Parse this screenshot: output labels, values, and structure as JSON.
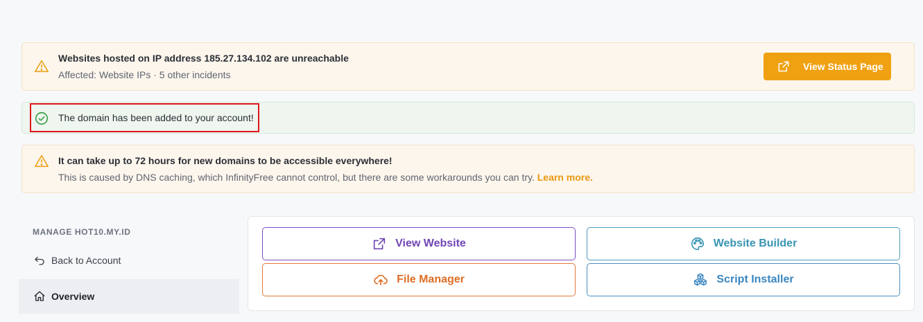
{
  "alerts": {
    "incident": {
      "title": "Websites hosted on IP address 185.27.134.102 are unreachable",
      "subtitle": "Affected: Website IPs · 5 other incidents",
      "button_label": "View Status Page",
      "icon": "warning-triangle-icon"
    },
    "success": {
      "text": "The domain has been added to your account!",
      "icon": "check-circle-icon"
    },
    "dns": {
      "title": "It can take up to 72 hours for new domains to be accessible everywhere!",
      "subtitle": "This is caused by DNS caching, which InfinityFree cannot control, but there are some workarounds you can try.",
      "link_label": "Learn more.",
      "icon": "warning-triangle-icon"
    }
  },
  "sidebar": {
    "heading": "MANAGE HOT10.MY.ID",
    "items": [
      {
        "label": "Back to Account",
        "icon": "arrow-back-icon"
      },
      {
        "label": "Overview",
        "icon": "home-icon",
        "active": true
      }
    ]
  },
  "tools": {
    "view_website": {
      "label": "View Website",
      "icon": "external-link-icon"
    },
    "website_builder": {
      "label": "Website Builder",
      "icon": "palette-icon"
    },
    "file_manager": {
      "label": "File Manager",
      "icon": "cloud-upload-icon"
    },
    "script_installer": {
      "label": "Script Installer",
      "icon": "cubes-icon"
    }
  },
  "colors": {
    "warning_accent": "#f0a112",
    "success_accent": "#3aa04a",
    "highlight": "#e0141c",
    "view_website": "#7045b6",
    "file_manager": "#de6d25",
    "website_builder": "#3994b3",
    "script_installer": "#3a86c0"
  }
}
